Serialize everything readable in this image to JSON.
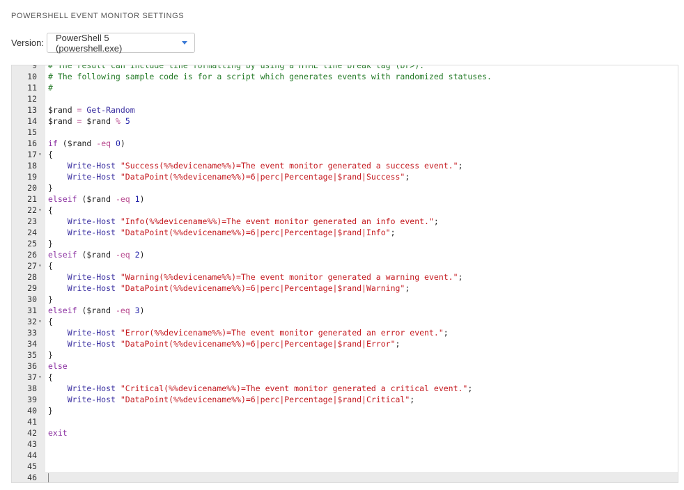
{
  "title": "POWERSHELL EVENT MONITOR SETTINGS",
  "version": {
    "label": "Version:",
    "selected": "PowerShell 5 (powershell.exe)"
  },
  "editor": {
    "lines": [
      {
        "n": "9",
        "fold": false,
        "tokens": [
          {
            "t": "# The result can include line formatting by using a HTML line break tag (br>).",
            "c": "comment"
          }
        ]
      },
      {
        "n": "10",
        "fold": false,
        "tokens": [
          {
            "t": "# The following sample code is for a script which generates events with randomized statuses.",
            "c": "comment"
          }
        ]
      },
      {
        "n": "11",
        "fold": false,
        "tokens": [
          {
            "t": "#",
            "c": "comment"
          }
        ]
      },
      {
        "n": "12",
        "fold": false,
        "tokens": []
      },
      {
        "n": "13",
        "fold": false,
        "tokens": [
          {
            "t": "$rand",
            "c": "var"
          },
          {
            "t": " = ",
            "c": "op"
          },
          {
            "t": "Get-Random",
            "c": "fn"
          }
        ]
      },
      {
        "n": "14",
        "fold": false,
        "tokens": [
          {
            "t": "$rand",
            "c": "var"
          },
          {
            "t": " = ",
            "c": "op"
          },
          {
            "t": "$rand",
            "c": "var"
          },
          {
            "t": " % ",
            "c": "op"
          },
          {
            "t": "5",
            "c": "num"
          }
        ]
      },
      {
        "n": "15",
        "fold": false,
        "tokens": []
      },
      {
        "n": "16",
        "fold": false,
        "tokens": [
          {
            "t": "if",
            "c": "kw"
          },
          {
            "t": " (",
            "c": "plain"
          },
          {
            "t": "$rand",
            "c": "var"
          },
          {
            "t": " -eq ",
            "c": "op"
          },
          {
            "t": "0",
            "c": "num"
          },
          {
            "t": ")",
            "c": "plain"
          }
        ]
      },
      {
        "n": "17",
        "fold": true,
        "tokens": [
          {
            "t": "{",
            "c": "plain"
          }
        ]
      },
      {
        "n": "18",
        "fold": false,
        "tokens": [
          {
            "t": "    Write-Host ",
            "c": "fn"
          },
          {
            "t": "\"Success(%%devicename%%)=The event monitor generated a success event.\"",
            "c": "str"
          },
          {
            "t": ";",
            "c": "plain"
          }
        ]
      },
      {
        "n": "19",
        "fold": false,
        "tokens": [
          {
            "t": "    Write-Host ",
            "c": "fn"
          },
          {
            "t": "\"DataPoint(%%devicename%%)=6|perc|Percentage|$rand|Success\"",
            "c": "str"
          },
          {
            "t": ";",
            "c": "plain"
          }
        ]
      },
      {
        "n": "20",
        "fold": false,
        "tokens": [
          {
            "t": "}",
            "c": "plain"
          }
        ]
      },
      {
        "n": "21",
        "fold": false,
        "tokens": [
          {
            "t": "elseif",
            "c": "kw"
          },
          {
            "t": " (",
            "c": "plain"
          },
          {
            "t": "$rand",
            "c": "var"
          },
          {
            "t": " -eq ",
            "c": "op"
          },
          {
            "t": "1",
            "c": "num"
          },
          {
            "t": ")",
            "c": "plain"
          }
        ]
      },
      {
        "n": "22",
        "fold": true,
        "tokens": [
          {
            "t": "{",
            "c": "plain"
          }
        ]
      },
      {
        "n": "23",
        "fold": false,
        "tokens": [
          {
            "t": "    Write-Host ",
            "c": "fn"
          },
          {
            "t": "\"Info(%%devicename%%)=The event monitor generated an info event.\"",
            "c": "str"
          },
          {
            "t": ";",
            "c": "plain"
          }
        ]
      },
      {
        "n": "24",
        "fold": false,
        "tokens": [
          {
            "t": "    Write-Host ",
            "c": "fn"
          },
          {
            "t": "\"DataPoint(%%devicename%%)=6|perc|Percentage|$rand|Info\"",
            "c": "str"
          },
          {
            "t": ";",
            "c": "plain"
          }
        ]
      },
      {
        "n": "25",
        "fold": false,
        "tokens": [
          {
            "t": "}",
            "c": "plain"
          }
        ]
      },
      {
        "n": "26",
        "fold": false,
        "tokens": [
          {
            "t": "elseif",
            "c": "kw"
          },
          {
            "t": " (",
            "c": "plain"
          },
          {
            "t": "$rand",
            "c": "var"
          },
          {
            "t": " -eq ",
            "c": "op"
          },
          {
            "t": "2",
            "c": "num"
          },
          {
            "t": ")",
            "c": "plain"
          }
        ]
      },
      {
        "n": "27",
        "fold": true,
        "tokens": [
          {
            "t": "{",
            "c": "plain"
          }
        ]
      },
      {
        "n": "28",
        "fold": false,
        "tokens": [
          {
            "t": "    Write-Host ",
            "c": "fn"
          },
          {
            "t": "\"Warning(%%devicename%%)=The event monitor generated a warning event.\"",
            "c": "str"
          },
          {
            "t": ";",
            "c": "plain"
          }
        ]
      },
      {
        "n": "29",
        "fold": false,
        "tokens": [
          {
            "t": "    Write-Host ",
            "c": "fn"
          },
          {
            "t": "\"DataPoint(%%devicename%%)=6|perc|Percentage|$rand|Warning\"",
            "c": "str"
          },
          {
            "t": ";",
            "c": "plain"
          }
        ]
      },
      {
        "n": "30",
        "fold": false,
        "tokens": [
          {
            "t": "}",
            "c": "plain"
          }
        ]
      },
      {
        "n": "31",
        "fold": false,
        "tokens": [
          {
            "t": "elseif",
            "c": "kw"
          },
          {
            "t": " (",
            "c": "plain"
          },
          {
            "t": "$rand",
            "c": "var"
          },
          {
            "t": " -eq ",
            "c": "op"
          },
          {
            "t": "3",
            "c": "num"
          },
          {
            "t": ")",
            "c": "plain"
          }
        ]
      },
      {
        "n": "32",
        "fold": true,
        "tokens": [
          {
            "t": "{",
            "c": "plain"
          }
        ]
      },
      {
        "n": "33",
        "fold": false,
        "tokens": [
          {
            "t": "    Write-Host ",
            "c": "fn"
          },
          {
            "t": "\"Error(%%devicename%%)=The event monitor generated an error event.\"",
            "c": "str"
          },
          {
            "t": ";",
            "c": "plain"
          }
        ]
      },
      {
        "n": "34",
        "fold": false,
        "tokens": [
          {
            "t": "    Write-Host ",
            "c": "fn"
          },
          {
            "t": "\"DataPoint(%%devicename%%)=6|perc|Percentage|$rand|Error\"",
            "c": "str"
          },
          {
            "t": ";",
            "c": "plain"
          }
        ]
      },
      {
        "n": "35",
        "fold": false,
        "tokens": [
          {
            "t": "}",
            "c": "plain"
          }
        ]
      },
      {
        "n": "36",
        "fold": false,
        "tokens": [
          {
            "t": "else",
            "c": "kw"
          }
        ]
      },
      {
        "n": "37",
        "fold": true,
        "tokens": [
          {
            "t": "{",
            "c": "plain"
          }
        ]
      },
      {
        "n": "38",
        "fold": false,
        "tokens": [
          {
            "t": "    Write-Host ",
            "c": "fn"
          },
          {
            "t": "\"Critical(%%devicename%%)=The event monitor generated a critical event.\"",
            "c": "str"
          },
          {
            "t": ";",
            "c": "plain"
          }
        ]
      },
      {
        "n": "39",
        "fold": false,
        "tokens": [
          {
            "t": "    Write-Host ",
            "c": "fn"
          },
          {
            "t": "\"DataPoint(%%devicename%%)=6|perc|Percentage|$rand|Critical\"",
            "c": "str"
          },
          {
            "t": ";",
            "c": "plain"
          }
        ]
      },
      {
        "n": "40",
        "fold": false,
        "tokens": [
          {
            "t": "}",
            "c": "plain"
          }
        ]
      },
      {
        "n": "41",
        "fold": false,
        "tokens": []
      },
      {
        "n": "42",
        "fold": false,
        "tokens": [
          {
            "t": "exit",
            "c": "kw"
          }
        ]
      },
      {
        "n": "43",
        "fold": false,
        "tokens": []
      },
      {
        "n": "44",
        "fold": false,
        "tokens": []
      },
      {
        "n": "45",
        "fold": false,
        "tokens": []
      },
      {
        "n": "46",
        "fold": false,
        "active": true,
        "tokens": []
      }
    ]
  }
}
